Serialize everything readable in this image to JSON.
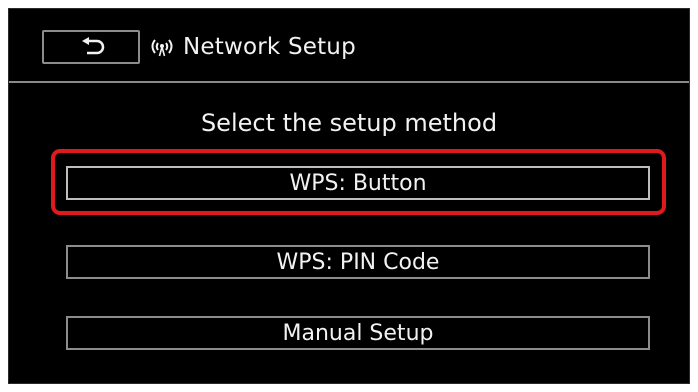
{
  "header": {
    "title": "Network Setup",
    "back_icon": "return-arrow-icon",
    "title_icon": "wireless-antenna-icon"
  },
  "prompt": "Select the setup method",
  "options": [
    {
      "label": "WPS: Button",
      "selected": true
    },
    {
      "label": "WPS: PIN Code",
      "selected": false
    },
    {
      "label": "Manual Setup",
      "selected": false
    }
  ],
  "colors": {
    "background": "#000000",
    "text": "#f2f2f2",
    "border": "#8c8c8c",
    "highlight": "#e0191d"
  }
}
